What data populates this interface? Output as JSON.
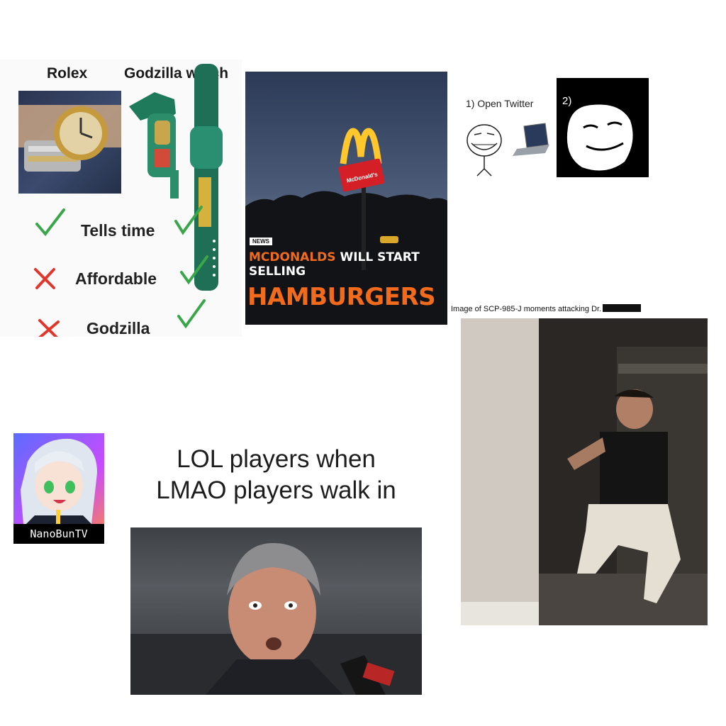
{
  "rolex_meme": {
    "header_left": "Rolex",
    "header_right": "Godzilla watch",
    "rows": [
      {
        "label": "Tells time",
        "rolex": "check",
        "godzilla": "check"
      },
      {
        "label": "Affordable",
        "rolex": "cross",
        "godzilla": "check"
      },
      {
        "label": "Godzilla",
        "rolex": "cross",
        "godzilla": "check"
      }
    ],
    "colors": {
      "check": "#3aa64a",
      "cross": "#e0362c"
    }
  },
  "mcdonalds_meme": {
    "tag": "NEWS",
    "headline_orange": "MCDONALDS",
    "headline_white": " WILL START",
    "headline_line2": "SELLING",
    "headline_big": "HAMBURGERS",
    "sign_text": "McDonald's",
    "colors": {
      "accent": "#f26b1d",
      "sign_red": "#d41f26",
      "arches": "#ffc72c"
    }
  },
  "troll_meme": {
    "step1": "1) Open Twitter",
    "step2": "2)"
  },
  "scp_meme": {
    "caption": "Image of SCP-985-J moments attacking Dr."
  },
  "nanobun": {
    "label": "NanoBunTV"
  },
  "lol_meme": {
    "line1": "LOL players when",
    "line2": "LMAO players walk in"
  }
}
